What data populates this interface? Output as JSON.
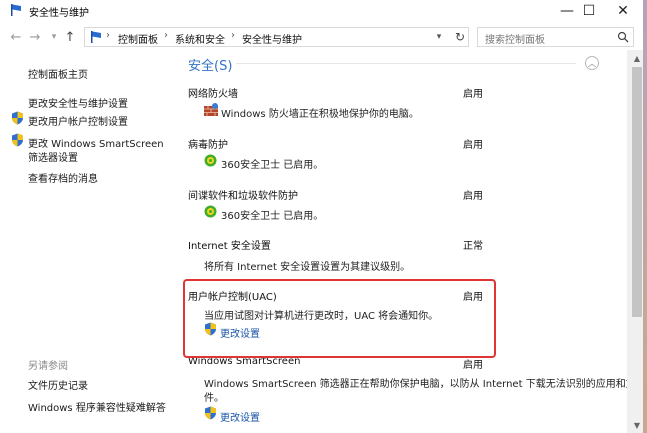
{
  "window": {
    "title": "安全性与维护",
    "minimize": "—",
    "maximize": "☐",
    "close": "✕"
  },
  "address": {
    "crumbs": [
      "控制面板",
      "系统和安全",
      "安全性与维护"
    ],
    "separator": "›",
    "search_placeholder": "搜索控制面板"
  },
  "sidebar": {
    "home": "控制面板主页",
    "links": [
      "更改安全性与维护设置",
      "更改用户帐户控制设置",
      "更改 Windows SmartScreen",
      "筛选器设置",
      "查看存档的消息"
    ],
    "see_also_title": "另请参阅",
    "see_also": [
      "文件历史记录",
      "Windows 程序兼容性疑难解答"
    ]
  },
  "main": {
    "section_title": "安全(S)",
    "items": [
      {
        "title": "网络防火墙",
        "status": "启用",
        "desc": "Windows 防火墙正在积极地保护你的电脑。"
      },
      {
        "title": "病毒防护",
        "status": "启用",
        "desc": "360安全卫士 已启用。"
      },
      {
        "title": "间谍软件和垃圾软件防护",
        "status": "启用",
        "desc": "360安全卫士 已启用。"
      },
      {
        "title": "Internet 安全设置",
        "status": "正常",
        "desc": "将所有 Internet 安全设置设置为其建议级别。"
      },
      {
        "title": "用户帐户控制(UAC)",
        "status": "启用",
        "desc": "当应用试图对计算机进行更改时，UAC 将会通知你。",
        "link": "更改设置"
      },
      {
        "title": "Windows SmartScreen",
        "status": "启用",
        "desc": "Windows SmartScreen 筛选器正在帮助你保护电脑，以防从 Internet 下载无法识别的应用和文",
        "desc2": "件。",
        "link": "更改设置"
      }
    ]
  }
}
